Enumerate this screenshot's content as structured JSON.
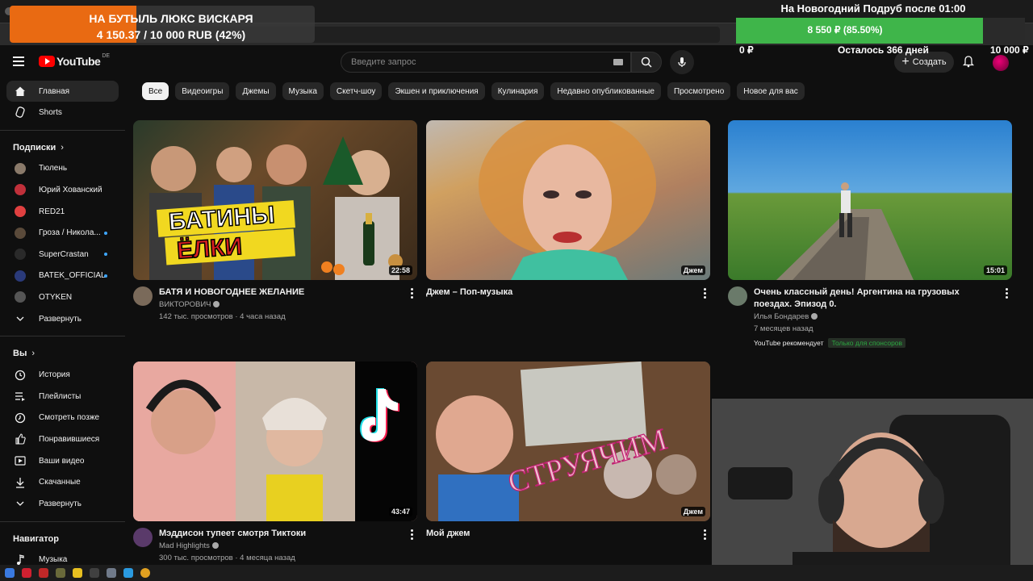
{
  "header": {
    "logo_text": "YouTube",
    "logo_country": "DE",
    "search_placeholder": "Введите запрос",
    "create_label": "Создать"
  },
  "sidebar": {
    "main": [
      {
        "label": "Главная",
        "icon": "home-icon",
        "active": true
      },
      {
        "label": "Shorts",
        "icon": "shorts-icon",
        "active": false
      }
    ],
    "subscriptions_title": "Подписки",
    "subscriptions": [
      {
        "label": "Тюлень",
        "color": "#8a7a6a",
        "live": false
      },
      {
        "label": "Юрий Хованский",
        "color": "#c0303a",
        "live": false
      },
      {
        "label": "RED21",
        "color": "#e04040",
        "live": false
      },
      {
        "label": "Гроза / Никола...",
        "color": "#5a4a3a",
        "live": true
      },
      {
        "label": "SuperCrastan",
        "color": "#2a2a2a",
        "live": true
      },
      {
        "label": "BATEK_OFFICIAL",
        "color": "#2a3a7a",
        "live": true
      },
      {
        "label": "OTYKEN",
        "color": "#555555",
        "live": false
      }
    ],
    "expand_label": "Развернуть",
    "you_title": "Вы",
    "you_items": [
      {
        "label": "История",
        "icon": "history-icon"
      },
      {
        "label": "Плейлисты",
        "icon": "playlists-icon"
      },
      {
        "label": "Смотреть позже",
        "icon": "watch-later-icon"
      },
      {
        "label": "Понравившиеся",
        "icon": "like-icon"
      },
      {
        "label": "Ваши видео",
        "icon": "your-videos-icon"
      },
      {
        "label": "Скачанные",
        "icon": "download-icon"
      }
    ],
    "expand_label_2": "Развернуть",
    "navigator_title": "Навигатор",
    "navigator_items": [
      {
        "label": "Музыка",
        "icon": "music-icon"
      }
    ]
  },
  "chips": [
    "Все",
    "Видеоигры",
    "Джемы",
    "Музыка",
    "Скетч-шоу",
    "Экшен и приключения",
    "Кулинария",
    "Недавно опубликованные",
    "Просмотрено",
    "Новое для вас"
  ],
  "videos": [
    {
      "title": "БАТЯ И НОВОГОДНЕЕ ЖЕЛАНИЕ",
      "channel": "ВИКТОРОВИЧ",
      "stats": "142 тыс. просмотров · 4 часа назад",
      "duration": "22:58",
      "thumb_text": "БАТИНЫ ЁЛКИ",
      "av": "#7a6a5a"
    },
    {
      "title": "Джем – Поп-музыка",
      "channel": "",
      "stats": "",
      "duration": "Джем",
      "av": ""
    },
    {
      "title": "Очень классный день! Аргентина на грузовых поездах. Эпизод 0.",
      "channel": "Илья Бондарев",
      "stats": "7 месяцев назад",
      "duration": "15:01",
      "recommended": "YouTube рекомендует",
      "sponsors": "Только для спонсоров",
      "av": "#6a7a6a"
    },
    {
      "title": "Мэддисон тупеет смотря Тиктоки",
      "channel": "Mad Highlights",
      "stats": "300 тыс. просмотров · 4 месяца назад",
      "duration": "43:47",
      "av": "#5a3a6a"
    },
    {
      "title": "Мой джем",
      "channel": "",
      "stats": "",
      "duration": "Джем",
      "thumb_text": "СТРУЯЧИМ",
      "av": ""
    }
  ],
  "donation": {
    "line1": "НА БУТЫЛЬ ЛЮКС ВИСКАРЯ",
    "line2": "4 150.37 / 10 000 RUB (42%)",
    "progress": 0.415
  },
  "subathon": {
    "title": "На Новогодний Подруб после 01:00",
    "bar_text": "8 550 ₽ (85.50%)",
    "progress": 0.855,
    "min_label": "0 ₽",
    "remaining": "Осталось 366 дней",
    "max_label": "10 000 ₽"
  },
  "colors": {
    "background": "#0f0f0f",
    "accent_red": "#ff0000",
    "progress_green": "#3fb54a",
    "donation_orange": "#e96a12"
  }
}
